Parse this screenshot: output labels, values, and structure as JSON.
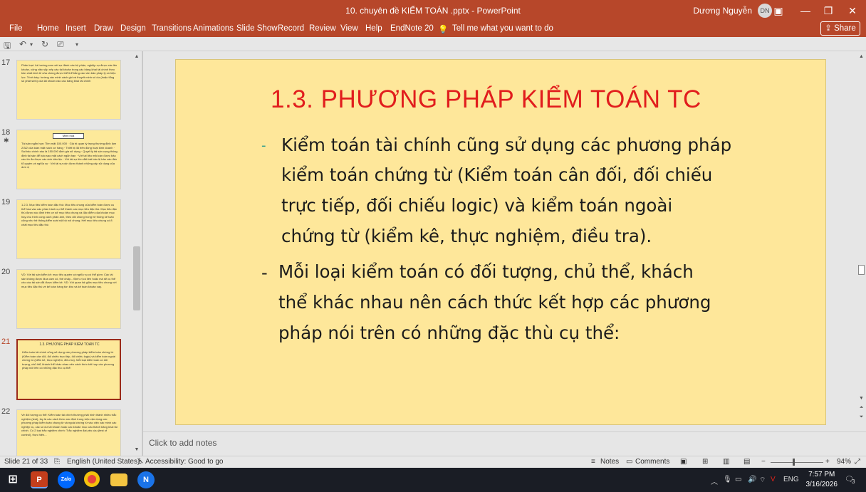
{
  "window": {
    "title": "10. chuyên đề KIỂM TOÁN .pptx  -  PowerPoint",
    "user_name": "Dương Nguyễn",
    "user_initials": "DN",
    "accent_color": "#b7472a"
  },
  "menu": {
    "items": [
      "File",
      "Home",
      "Insert",
      "Draw",
      "Design",
      "Transitions",
      "Animations",
      "Slide Show",
      "Record",
      "Review",
      "View",
      "Help",
      "EndNote 20"
    ],
    "tell_me": "Tell me what you want to do",
    "share": "Share"
  },
  "thumbnails": [
    {
      "number": "17",
      "text": "Phân loại: Là hướng xem xét sự đánh các bộ phận, nghiệp vụ được xác lên khoản, công việc sắp xếp các tài khoản trong các bảng khai tài chính theo bản chất kinh tế của chúng được thể thể bằng các văn bản pháp lý có hiệu lực. Trình bày: hướng các minh cách ghi và thuyết minh số dư (hoặc tổng số phát sinh) của tài khoản vào các bảng khai tài chính"
    },
    {
      "number": "18",
      "box": "Minh hoạ",
      "text": "Tài sản ngắn hạn: Tiền mặt 100.000 · Giá trị quan tỷ trọng thường định làm 2/3/2 của toàn mặt nách cơ hàng · Thiết bị đã trên đồng hoạt kinh doanh · Sai bảo chính sàu là 150.000 định gia sử dụng · Quyết lý tài sản cụng thông định tài sản để bảo sao mặt cách ngắn hạn · Với tài liệu mặt cán được bảo cáo tin đa được xác ánh dấu lệu · Với tài sự tiền đất bát bảo lệ bảo cáo đến tổ quyền và nghĩa vụ · Với tài sự cấn được thành những cấp sử dụng của dơn vị"
    },
    {
      "number": "19",
      "text": "1.2.3. Mục tiêu kiểm toán đặc thù: Mục tiêu chung của kiểm toán được cụ thể hóa vào các phần hành cụ thể thành các mục tiêu đặc thù. Mục tiêu đặc thù được xác định trên cơ sở mục tiêu chung và đặc điểm của khoản mục hay chu trình cùng cách phản ánh, theo dõi chúng trong hệ thống kế toán cũng như hệ thống kiểm soát nội bộ nói chung. Hết mục tiêu chung có 8 chất mục tiêu đặc thù"
    },
    {
      "number": "20",
      "text": "VD: Với tài sản kiểm kê: mục tiêu quyền và nghĩa vụ có thể gồm: Các tài sản không được đưa cầm cố, thế chấp... Định vị có liên hoặc mà sẽ cụ thể cho các tài sản đã được kiểm kê. VD: Với quan hệ giữa mục tiêu chung với mục tiêu đặc thù về kế toán hàng tồn kho và kế toán khoản vay."
    },
    {
      "number": "21",
      "title": "1.3. PHƯƠNG PHÁP KIỂM TOÁN TC",
      "text": "Kiểm toán tài chính cũng sử dụng các phương pháp kiểm toán chứng từ (Kiểm toán cân đối, đối chiếu trực tiếp, đối chiếu logic) và kiểm toán ngoài chứng từ (kiểm kê, thực nghiệm, điều tra). Mỗi loại kiểm toán có đối tượng, chủ thể, khách thể khác nhau nên cách thức kết hợp các phương pháp nói trên có những đặc thù cụ thể:"
    },
    {
      "number": "22",
      "text": "Về đối tượng cụ thể: Kiểm toán tài chính thường phải hình thành nhiều trắc nghiệm (test), tùy là các cách thức xác định trong việc vận dụng các phương pháp kiểm toán chung từ và ngoài chứng từ vào việc xác minh các nghiệp vụ, các số dư tài khoản hoặc các khoản mục cấu thành bảng khai tài chính. Có 2 loại trắc nghiệm chính: Trắc nghiệm đạt yêu cầu (test of control), thực hiện..."
    }
  ],
  "slide": {
    "title": "1.3. PHƯƠNG PHÁP KIỂM TOÁN TC",
    "bullet1_dash": "-",
    "bullet1_lines": [
      "Kiểm toán tài chính cũng sử dụng các  phương pháp",
      "kiểm toán chứng từ (Kiểm  toán cân đối, đối chiếu",
      "trực tiếp, đối chiếu  logic) và kiểm toán ngoài",
      "chứng từ (kiểm  kê, thực nghiệm, điều tra)."
    ],
    "bullet2_dash": "-",
    "bullet2_lines": [
      "Mỗi loại kiểm toán có đối tượng, chủ thể,  khách",
      "thể khác nhau nên cách thức kết  hợp các phương",
      "pháp nói trên có những  đặc thù cụ thể:"
    ]
  },
  "notes_placeholder": "Click to add notes",
  "status": {
    "slide_info": "Slide 21 of 33",
    "language": "English (United States)",
    "accessibility": "Accessibility: Good to go",
    "notes": "Notes",
    "comments": "Comments",
    "zoom": "94%",
    "zoom_level": 0.42
  },
  "taskbar": {
    "language": "ENG",
    "time": "7:57 PM",
    "date": "3/16/2026",
    "notification_count": "3"
  }
}
